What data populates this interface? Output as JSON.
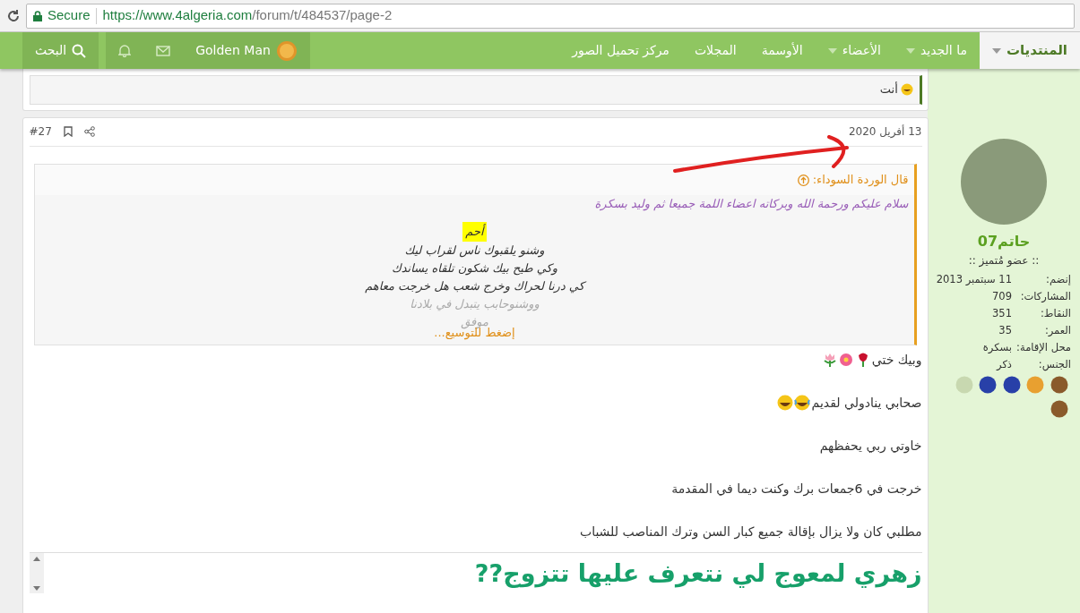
{
  "browser": {
    "secure_label": "Secure",
    "url_host": "https://www.4algeria.com",
    "url_path": "/forum/t/484537/page-2"
  },
  "nav": {
    "items": [
      {
        "label": "المنتديات",
        "selected": true,
        "dropdown": true
      },
      {
        "label": "ما الجديد",
        "selected": false,
        "dropdown": true
      },
      {
        "label": "الأعضاء",
        "selected": false,
        "dropdown": true
      },
      {
        "label": "الأوسمة",
        "selected": false,
        "dropdown": false
      },
      {
        "label": "المجلات",
        "selected": false,
        "dropdown": false
      },
      {
        "label": "مركز تحميل الصور",
        "selected": false,
        "dropdown": false
      }
    ],
    "user_name": "Golden Man",
    "search_label": "البحث"
  },
  "previous_post": {
    "text": "أنت"
  },
  "post": {
    "date": "13 أفريل 2020",
    "number": "#27",
    "quote": {
      "author": "قال الوردة السوداء:",
      "lines": [
        {
          "text": "سلام عليكم ورحمة الله وبركاته اعضاء اللمة جميعا ثم وليد بسكرة",
          "kind": "intro"
        },
        {
          "text": "أحم",
          "kind": "highlight"
        },
        {
          "text": "وشنو يلقبوك ناس لقراب ليك",
          "kind": "verse"
        },
        {
          "text": "وكي طيح بيك شكون تلقاه يساندك",
          "kind": "verse"
        },
        {
          "text": "كي درنا لحراك وخرج شعب هل خرجت معاهم",
          "kind": "verse"
        },
        {
          "text": "ووشنوحابب يتبدل في بلادنا",
          "kind": "faded"
        },
        {
          "text": "موفق",
          "kind": "faded"
        }
      ],
      "expand_label": "إضغط للتوسيع..."
    },
    "paragraphs": [
      {
        "text": "وبيك ختي",
        "kind": "flowers"
      },
      {
        "text": "صحابي ينادولي لقديم",
        "kind": "laughing"
      },
      {
        "text": "خاوتي ربي يحفظهم",
        "kind": "plain"
      },
      {
        "text": "خرجت في 6جمعات برك وكنت ديما في المقدمة",
        "kind": "plain"
      },
      {
        "text": "مطلبي كان ولا يزال بإقالة جميع كبار السن وترك المناصب للشباب",
        "kind": "plain"
      }
    ],
    "heading": "زهري لمعوج لي نتعرف عليها تتزوج??"
  },
  "author": {
    "username": "حاتم07",
    "title": ":: عضو مُتميز ::",
    "stats": [
      {
        "label": "إنضم:",
        "value": "11 سبتمبر 2013"
      },
      {
        "label": "المشاركات:",
        "value": "709"
      },
      {
        "label": "النقاط:",
        "value": "351"
      },
      {
        "label": "العمر:",
        "value": "35"
      },
      {
        "label": "محل الإقامة:",
        "value": "بسكرة"
      },
      {
        "label": "الجنس:",
        "value": "ذكر"
      }
    ],
    "badges": [
      {
        "color": "#8a5a2b"
      },
      {
        "color": "#e8a030"
      },
      {
        "color": "#2840a8"
      },
      {
        "color": "#2840a8"
      },
      {
        "color": "#c8d8b0"
      },
      {
        "color": "#8a5a2b"
      }
    ]
  }
}
